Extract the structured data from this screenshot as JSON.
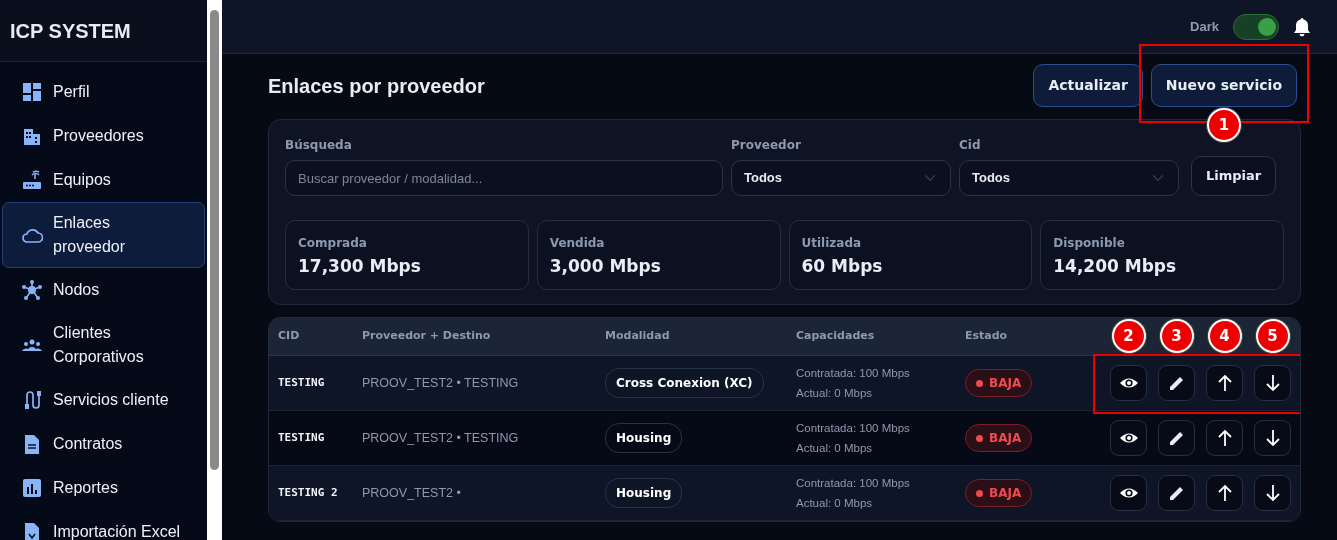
{
  "app": {
    "title": "ICP SYSTEM"
  },
  "sidebar": {
    "items": [
      {
        "label": "Perfil",
        "selected": false
      },
      {
        "label": "Proveedores",
        "selected": false
      },
      {
        "label": "Equipos",
        "selected": false
      },
      {
        "label": "Enlaces proveedor",
        "selected": true
      },
      {
        "label": "Nodos",
        "selected": false
      },
      {
        "label": "Clientes Corporativos",
        "selected": false
      },
      {
        "label": "Servicios cliente",
        "selected": false
      },
      {
        "label": "Contratos",
        "selected": false
      },
      {
        "label": "Reportes",
        "selected": false
      },
      {
        "label": "Importación Excel",
        "selected": false
      }
    ]
  },
  "topbar": {
    "theme_label": "Dark",
    "dark_mode_on": true
  },
  "page": {
    "title": "Enlaces por proveedor",
    "buttons": [
      "Actualizar",
      "Nuevo servicio"
    ]
  },
  "filters": {
    "search": {
      "label": "Búsqueda",
      "placeholder": "Buscar proveedor / modalidad..."
    },
    "provider": {
      "label": "Proveedor",
      "value": "Todos"
    },
    "cid": {
      "label": "Cid",
      "value": "Todos"
    },
    "clear_button": "Limpiar"
  },
  "stats": [
    {
      "label": "Comprada",
      "value": "17,300 Mbps"
    },
    {
      "label": "Vendida",
      "value": "3,000 Mbps"
    },
    {
      "label": "Utilizada",
      "value": "60 Mbps"
    },
    {
      "label": "Disponible",
      "value": "14,200 Mbps"
    }
  ],
  "table": {
    "columns": [
      "CID",
      "Proveedor + Destino",
      "Modalidad",
      "Capacidades",
      "Estado"
    ],
    "rows": [
      {
        "cid": "TESTING",
        "provider": "PROOV_TEST2 • TESTING",
        "modality": "Cross Conexion (XC)",
        "contracted": "Contratada: 100 Mbps",
        "current": "Actual: 0 Mbps",
        "status": {
          "label": "BAJA",
          "kind": "danger"
        }
      },
      {
        "cid": "TESTING",
        "provider": "PROOV_TEST2 • TESTING",
        "modality": "Housing",
        "contracted": "Contratada: 100 Mbps",
        "current": "Actual: 0 Mbps",
        "status": {
          "label": "BAJA",
          "kind": "danger"
        }
      },
      {
        "cid": "TESTING 2",
        "provider": "PROOV_TEST2 •",
        "modality": "Housing",
        "contracted": "Contratada: 100 Mbps",
        "current": "Actual: 0 Mbps",
        "status": {
          "label": "BAJA",
          "kind": "danger"
        }
      }
    ]
  },
  "callouts": [
    {
      "label": "1"
    },
    {
      "label": "2"
    },
    {
      "label": "3"
    },
    {
      "label": "4"
    },
    {
      "label": "5"
    }
  ]
}
